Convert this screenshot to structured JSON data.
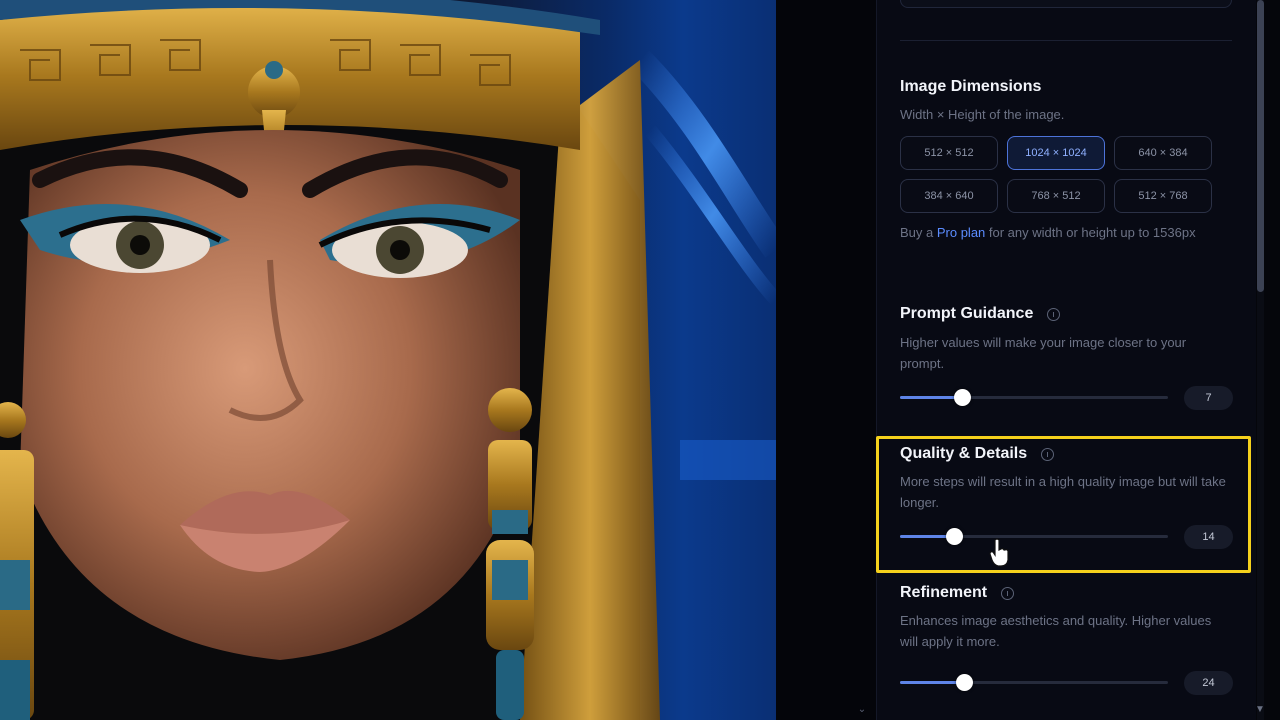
{
  "artwork": {
    "subject": "portrait-image",
    "colors": {
      "skin": "#b57a5c",
      "gold": "#b88a2c",
      "turquoise": "#2a6a86",
      "background_blue": "#0b3a8c"
    }
  },
  "panel": {
    "image_dimensions": {
      "title": "Image Dimensions",
      "description": "Width × Height of the image.",
      "options": [
        "512 × 512",
        "1024 × 1024",
        "640 × 384",
        "384 × 640",
        "768 × 512",
        "512 × 768"
      ],
      "selected": "1024 × 1024",
      "note_prefix": "Buy a ",
      "note_link": "Pro plan",
      "note_suffix": " for any width or height up to 1536px"
    },
    "prompt_guidance": {
      "title": "Prompt Guidance",
      "description": "Higher values will make your image closer to your prompt.",
      "value": "7",
      "fraction": 0.23
    },
    "quality_details": {
      "title": "Quality & Details",
      "description": "More steps will result in a high quality image but will take longer.",
      "value": "14",
      "fraction": 0.2
    },
    "refinement": {
      "title": "Refinement",
      "description": "Enhances image aesthetics and quality. Higher values will apply it more.",
      "value": "24",
      "fraction": 0.24
    }
  },
  "colors": {
    "accent": "#5e84e8",
    "highlight": "#f5d11c",
    "link": "#5b8cff"
  }
}
